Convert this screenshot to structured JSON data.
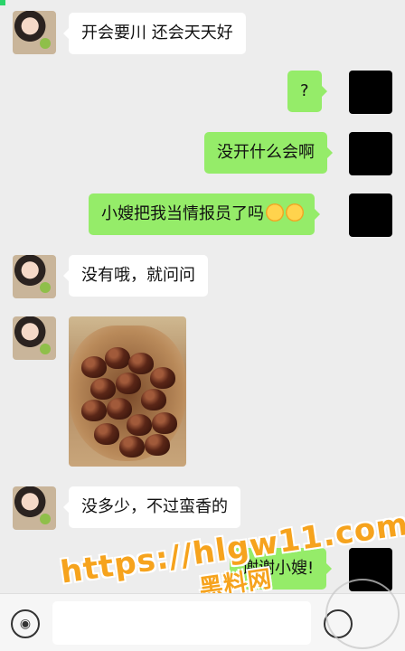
{
  "messages": [
    {
      "side": "in",
      "text": "开会要川 还会天天好"
    },
    {
      "side": "out",
      "text": "?"
    },
    {
      "side": "out",
      "text": "没开什么会啊"
    },
    {
      "side": "out",
      "text": "小嫂把我当情报员了吗"
    },
    {
      "side": "in",
      "text": "没有哦，就问问"
    },
    {
      "side": "in",
      "text": "[image]"
    },
    {
      "side": "in",
      "text": "没多少，不过蛮香的"
    },
    {
      "side": "out",
      "text": "谢谢小嫂!"
    }
  ],
  "watermark": {
    "url": "https://hlgw11.com",
    "name": "黑料网"
  },
  "input_bar": {
    "placeholder": ""
  },
  "colors": {
    "background": "#ededed",
    "out_bubble": "#95ec69",
    "in_bubble": "#ffffff",
    "watermark": "#f6a31d"
  },
  "icons": [
    "voice-icon",
    "emoji-icon",
    "laugh-cry-emoji"
  ]
}
